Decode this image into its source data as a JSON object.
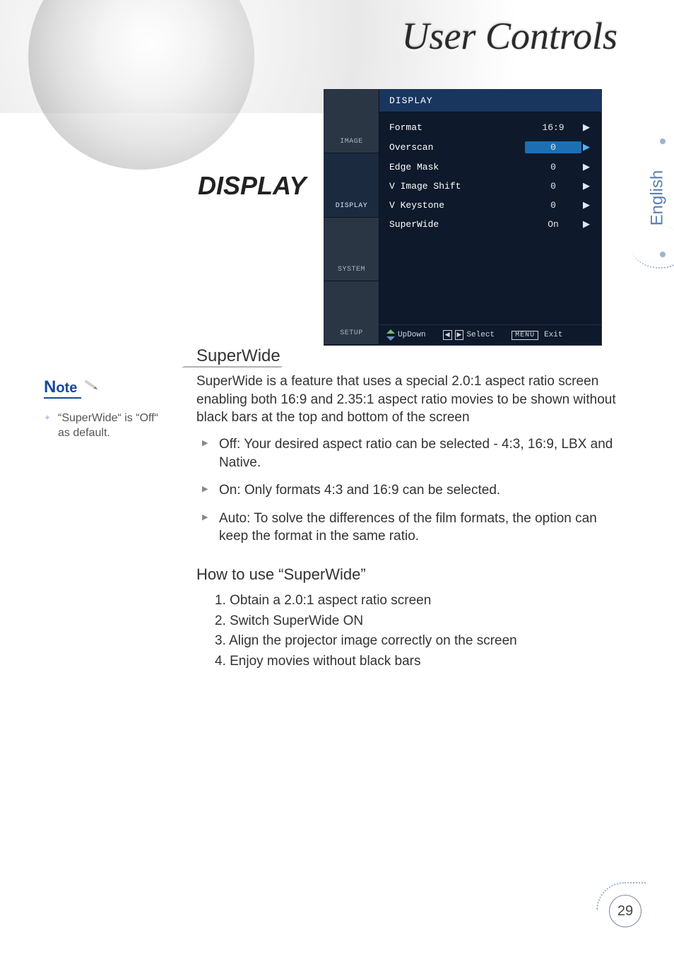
{
  "page": {
    "title": "User Controls",
    "section_title": "DISPLAY",
    "language_tab": "English",
    "page_number": "29"
  },
  "osd": {
    "header": "DISPLAY",
    "tabs": [
      "IMAGE",
      "DISPLAY",
      "SYSTEM",
      "SETUP"
    ],
    "active_tab_index": 1,
    "rows": [
      {
        "label": "Format",
        "value": "16:9",
        "highlight": false
      },
      {
        "label": "Overscan",
        "value": "0",
        "highlight": true
      },
      {
        "label": "Edge Mask",
        "value": "0",
        "highlight": false
      },
      {
        "label": "V Image Shift",
        "value": "0",
        "highlight": false
      },
      {
        "label": "V Keystone",
        "value": "0",
        "highlight": false
      },
      {
        "label": "SuperWide",
        "value": "On",
        "highlight": false
      }
    ],
    "footer": {
      "updown": "UpDown",
      "select": "Select",
      "menu_key": "MENU",
      "exit": "Exit"
    }
  },
  "note": {
    "label": "Note",
    "items": [
      "“SuperWide“ is “Off“ as default."
    ]
  },
  "body": {
    "subhead": "SuperWide",
    "intro": "SuperWide is a feature that uses a special 2.0:1 aspect ratio screen enabling both 16:9 and 2.35:1 aspect ratio movies to be shown without black bars at the top and bottom of the screen",
    "bullets": [
      "Off: Your desired aspect ratio can be selected - 4:3, 16:9, LBX and Native.",
      "On: Only formats 4:3 and 16:9 can be selected.",
      "Auto: To solve the differences of the film formats, the option can keep the format in the same ratio."
    ],
    "howto_head": "How to use “SuperWide”",
    "steps": [
      "1.  Obtain a 2.0:1 aspect ratio screen",
      "2.  Switch SuperWide ON",
      "3.  Align the projector image correctly on the screen",
      "4.  Enjoy movies without black bars"
    ]
  }
}
